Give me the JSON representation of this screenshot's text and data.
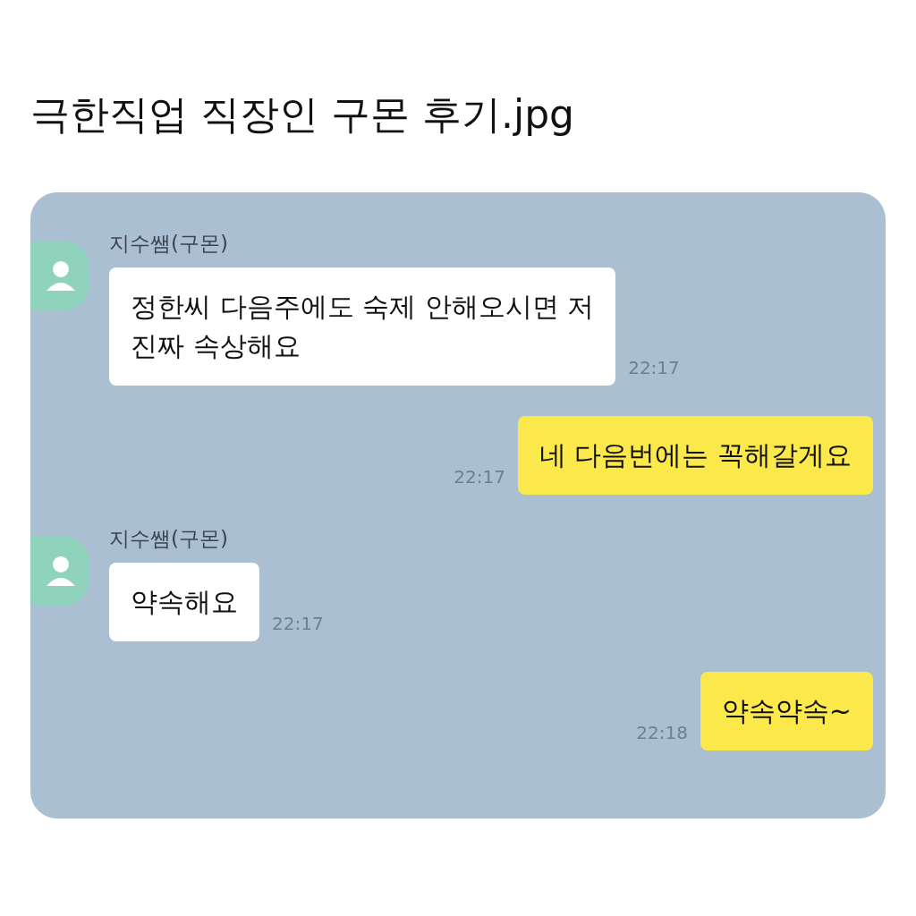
{
  "title": "극한직업 직장인 구몬 후기.jpg",
  "messages": [
    {
      "kind": "received",
      "sender": "지수쌤(구몬)",
      "text": "정한씨 다음주에도 숙제 안해오시면 저\n진짜 속상해요",
      "time": "22:17"
    },
    {
      "kind": "sent",
      "text": "네 다음번에는 꼭해갈게요",
      "time": "22:17"
    },
    {
      "kind": "received",
      "sender": "지수쌤(구몬)",
      "text": "약속해요",
      "time": "22:17"
    },
    {
      "kind": "sent",
      "text": "약속약속~",
      "time": "22:18"
    }
  ]
}
